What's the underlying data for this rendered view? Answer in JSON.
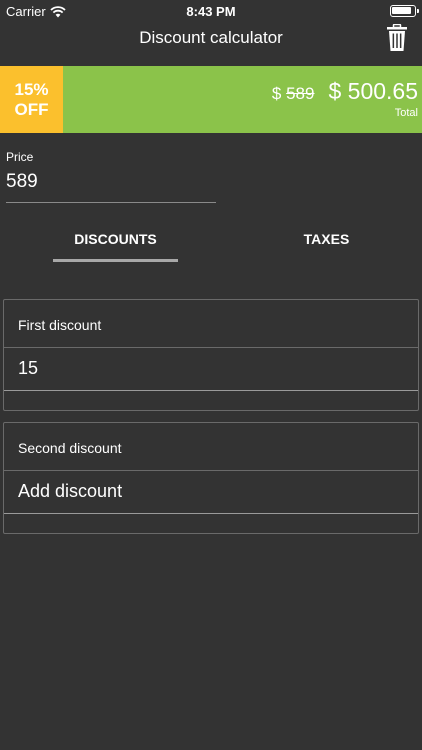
{
  "status_bar": {
    "carrier": "Carrier",
    "time": "8:43 PM"
  },
  "nav": {
    "title": "Discount calculator",
    "trash_icon": "trash-icon"
  },
  "banner": {
    "badge_percent": "15%",
    "badge_off": "OFF",
    "currency": "$",
    "original_price": "589",
    "new_price": "$ 500.65",
    "total_label": "Total",
    "colors": {
      "badge": "#fbc02d",
      "bar": "#8bc34a"
    }
  },
  "price": {
    "label": "Price",
    "value": "589"
  },
  "tabs": [
    {
      "label": "DISCOUNTS",
      "selected": true
    },
    {
      "label": "TAXES",
      "selected": false
    }
  ],
  "discounts": [
    {
      "label": "First discount",
      "value": "15"
    },
    {
      "label": "Second discount",
      "value": "Add discount"
    }
  ]
}
